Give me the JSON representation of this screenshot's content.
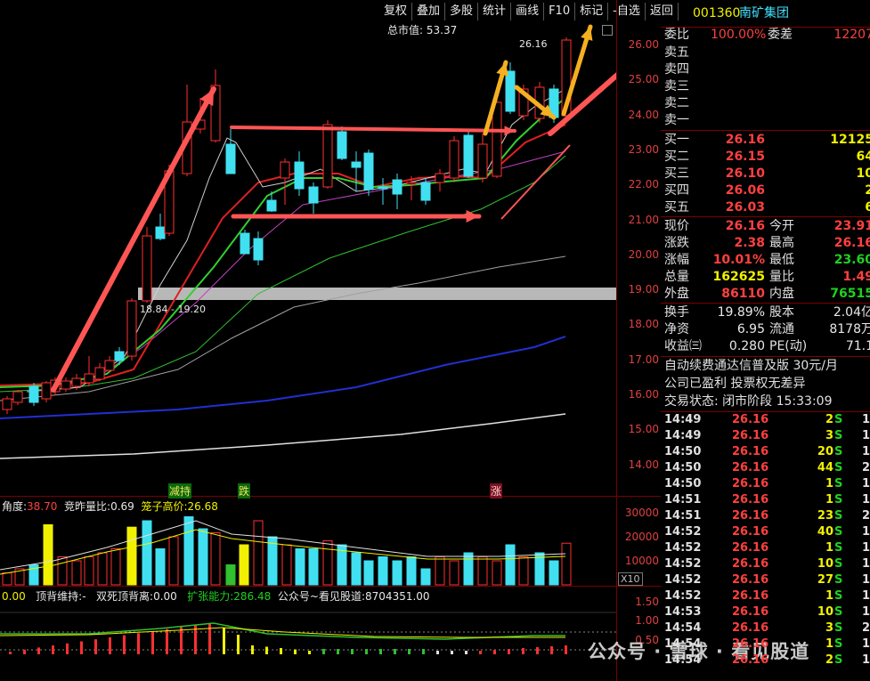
{
  "toolbar": [
    "复权",
    "叠加",
    "多股",
    "统计",
    "画线",
    "F10",
    "标记",
    "-自选",
    "返回"
  ],
  "stock": {
    "code": "001360",
    "name": "南矿集团"
  },
  "main_chart": {
    "market_cap_label": "总市值: 53.37",
    "price_axis": [
      "26.00",
      "25.00",
      "24.00",
      "23.00",
      "22.00",
      "21.00",
      "20.00",
      "19.00",
      "18.00",
      "17.00",
      "16.00",
      "15.00",
      "14.00"
    ],
    "high_mark": "26.16",
    "band_label": "18.84 - 19.20",
    "event_tags": [
      "减持",
      "跌",
      "涨"
    ]
  },
  "volume_panel": {
    "indicator_line": {
      "a_label": "角度:",
      "a_value": "38.70",
      "b_label": "竞昨量比:",
      "b_value": "0.69",
      "c_label": "笼子高价:",
      "c_value": "26.68"
    },
    "axis": [
      "30000",
      "20000",
      "10000"
    ],
    "unit": "X10"
  },
  "indicator_panel": {
    "line": {
      "a_label": "0.00",
      "b_label": "顶背维持:",
      "b_value": "-",
      "c_label": "双死顶背离:",
      "c_value": "0.00",
      "d_label": "扩张能力:",
      "d_value": "286.48",
      "e_label": "公众号~看见股道:",
      "e_value": "8704351.00"
    },
    "axis": [
      "1.50",
      "1.00",
      "0.50"
    ]
  },
  "watermark": "公众号 · 雪球 · 看见股道",
  "quote": {
    "ratio": {
      "l1": "委比",
      "v1": "100.00%",
      "l2": "委差",
      "v2": "12207"
    },
    "asks": [
      {
        "label": "卖五"
      },
      {
        "label": "卖四"
      },
      {
        "label": "卖三"
      },
      {
        "label": "卖二"
      },
      {
        "label": "卖一"
      }
    ],
    "bids": [
      {
        "label": "买一",
        "price": "26.16",
        "vol": "12125"
      },
      {
        "label": "买二",
        "price": "26.15",
        "vol": "64"
      },
      {
        "label": "买三",
        "price": "26.10",
        "vol": "10"
      },
      {
        "label": "买四",
        "price": "26.06",
        "vol": "2"
      },
      {
        "label": "买五",
        "price": "26.03",
        "vol": "6"
      }
    ],
    "stats": [
      {
        "l1": "现价",
        "v1": "26.16",
        "l2": "今开",
        "v2": "23.91"
      },
      {
        "l1": "涨跌",
        "v1": "2.38",
        "l2": "最高",
        "v2": "26.16"
      },
      {
        "l1": "涨幅",
        "v1": "10.01%",
        "l2": "最低",
        "v2": "23.60"
      },
      {
        "l1": "总量",
        "v1": "162625",
        "l2": "量比",
        "v2": "1.49"
      },
      {
        "l1": "外盘",
        "v1": "86110",
        "l2": "内盘",
        "v2": "76515"
      }
    ],
    "stats2": [
      {
        "l1": "换手",
        "v1": "19.89%",
        "l2": "股本",
        "v2": "2.04亿"
      },
      {
        "l1": "净资",
        "v1": "6.95",
        "l2": "流通",
        "v2": "8178万"
      },
      {
        "l1": "收益㈢",
        "v1": "0.280",
        "l2": "PE(动)",
        "v2": "71.1"
      }
    ],
    "info1": "自动续费通达信普及版  30元/月",
    "info2": "公司已盈利 投票权无差异",
    "info3": "交易状态: 闭市阶段 15:33:09"
  },
  "ticks": [
    {
      "t": "14:49",
      "p": "26.16",
      "q": "2",
      "s": "S",
      "n": "1"
    },
    {
      "t": "14:49",
      "p": "26.16",
      "q": "3",
      "s": "S",
      "n": "1"
    },
    {
      "t": "14:50",
      "p": "26.16",
      "q": "20",
      "s": "S",
      "n": "1"
    },
    {
      "t": "14:50",
      "p": "26.16",
      "q": "44",
      "s": "S",
      "n": "2"
    },
    {
      "t": "14:50",
      "p": "26.16",
      "q": "1",
      "s": "S",
      "n": "1"
    },
    {
      "t": "14:51",
      "p": "26.16",
      "q": "1",
      "s": "S",
      "n": "1"
    },
    {
      "t": "14:51",
      "p": "26.16",
      "q": "23",
      "s": "S",
      "n": "2"
    },
    {
      "t": "14:52",
      "p": "26.16",
      "q": "40",
      "s": "S",
      "n": "1"
    },
    {
      "t": "14:52",
      "p": "26.16",
      "q": "1",
      "s": "S",
      "n": "1"
    },
    {
      "t": "14:52",
      "p": "26.16",
      "q": "10",
      "s": "S",
      "n": "1"
    },
    {
      "t": "14:52",
      "p": "26.16",
      "q": "27",
      "s": "S",
      "n": "1"
    },
    {
      "t": "14:52",
      "p": "26.16",
      "q": "1",
      "s": "S",
      "n": "1"
    },
    {
      "t": "14:53",
      "p": "26.16",
      "q": "10",
      "s": "S",
      "n": "1"
    },
    {
      "t": "14:54",
      "p": "26.16",
      "q": "3",
      "s": "S",
      "n": "2"
    },
    {
      "t": "14:54",
      "p": "26.16",
      "q": "1",
      "s": "S",
      "n": "1"
    },
    {
      "t": "14:54",
      "p": "26.16",
      "q": "2",
      "s": "S",
      "n": "1"
    }
  ]
}
